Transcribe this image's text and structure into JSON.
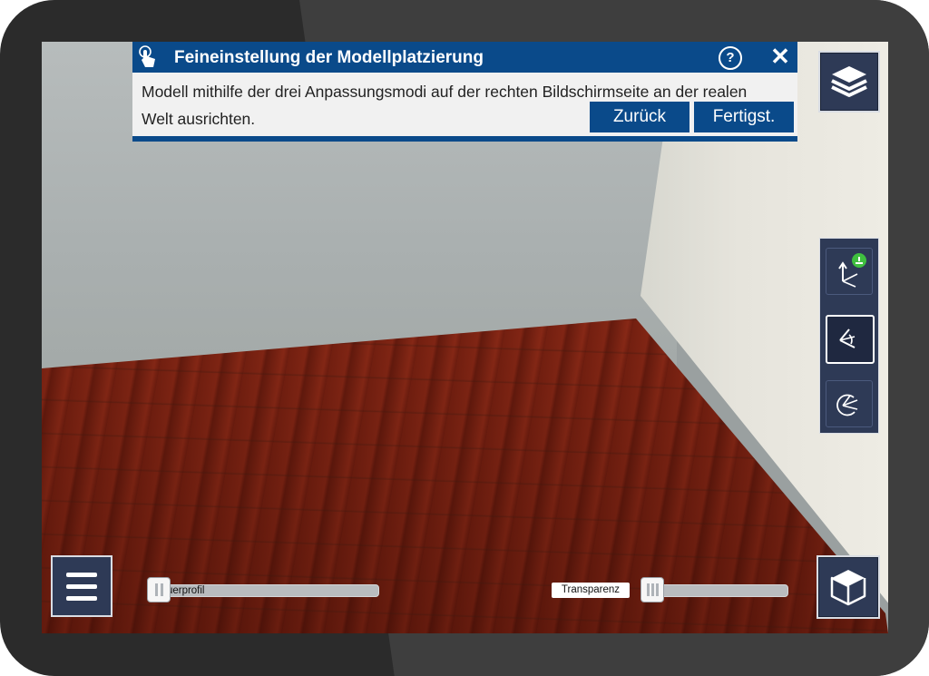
{
  "panel": {
    "title": "Feineinstellung der Modellplatzierung",
    "help_symbol": "?",
    "close_symbol": "✕",
    "instruction": "Modell mithilfe der drei Anpassungsmodi auf der rechten Bildschirmseite an der realen Welt ausrichten.",
    "back_label": "Zurück",
    "done_label": "Fertigst.",
    "icon": "tap-gesture-icon"
  },
  "sliders": {
    "cross_section_label": "Querprofil",
    "cross_section_value": 0.0,
    "transparency_label": "Transparenz",
    "transparency_value": 0.05
  },
  "tools": [
    {
      "name": "move-axis-tool",
      "active": false
    },
    {
      "name": "rotate-axis-tool",
      "active": true
    },
    {
      "name": "rotation-arc-tool",
      "active": false
    }
  ],
  "colors": {
    "panel_accent": "#0a4a8a",
    "button_bg": "#2e3a56",
    "status_green": "#55d055"
  }
}
